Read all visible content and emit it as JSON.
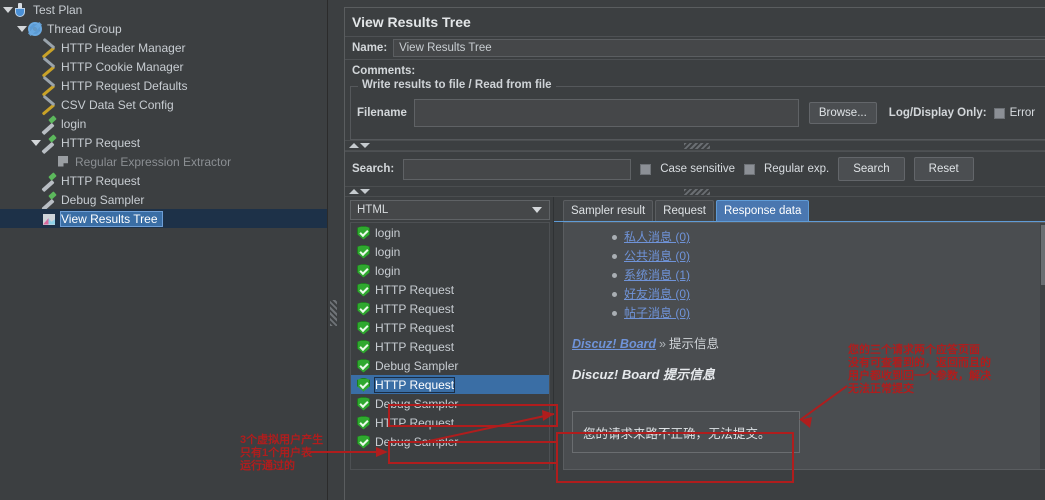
{
  "tree": {
    "items": [
      {
        "label": "Test Plan",
        "icon": "flask-icon",
        "indent": 0,
        "toggle": "open",
        "state": "normal"
      },
      {
        "label": "Thread Group",
        "icon": "gear-icon",
        "indent": 1,
        "toggle": "open",
        "state": "normal"
      },
      {
        "label": "HTTP Header Manager",
        "icon": "wrench-icon",
        "indent": 2,
        "toggle": "none",
        "state": "normal"
      },
      {
        "label": "HTTP Cookie Manager",
        "icon": "wrench-icon",
        "indent": 2,
        "toggle": "none",
        "state": "normal"
      },
      {
        "label": "HTTP Request Defaults",
        "icon": "wrench-icon",
        "indent": 2,
        "toggle": "none",
        "state": "normal"
      },
      {
        "label": "CSV Data Set Config",
        "icon": "wrench-icon",
        "indent": 2,
        "toggle": "none",
        "state": "normal"
      },
      {
        "label": "login",
        "icon": "pen-icon",
        "indent": 2,
        "toggle": "none",
        "state": "normal"
      },
      {
        "label": "HTTP Request",
        "icon": "pen-icon",
        "indent": 2,
        "toggle": "open",
        "state": "normal"
      },
      {
        "label": "Regular Expression Extractor",
        "icon": "flag-icon",
        "indent": 3,
        "toggle": "none",
        "state": "disabled"
      },
      {
        "label": "HTTP Request",
        "icon": "pen-icon",
        "indent": 2,
        "toggle": "none",
        "state": "normal"
      },
      {
        "label": "Debug Sampler",
        "icon": "pen-icon",
        "indent": 2,
        "toggle": "none",
        "state": "normal"
      },
      {
        "label": "View Results Tree",
        "icon": "chart-icon",
        "indent": 2,
        "toggle": "none",
        "state": "selected"
      }
    ]
  },
  "panel": {
    "title": "View Results Tree",
    "name_label": "Name:",
    "name_value": "View Results Tree",
    "comments_label": "Comments:",
    "comments_value": "",
    "file_group_legend": "Write results to file / Read from file",
    "filename_label": "Filename",
    "filename_value": "",
    "browse_label": "Browse...",
    "log_display_label": "Log/Display Only:",
    "errors_label": "Error"
  },
  "search": {
    "label": "Search:",
    "value": "",
    "case_sensitive_label": "Case sensitive",
    "regular_exp_label": "Regular exp.",
    "search_button": "Search",
    "reset_button": "Reset"
  },
  "renderer": {
    "selected": "HTML"
  },
  "samples": [
    {
      "label": "login",
      "status": "success",
      "selected": false
    },
    {
      "label": "login",
      "status": "success",
      "selected": false
    },
    {
      "label": "login",
      "status": "success",
      "selected": false
    },
    {
      "label": "HTTP Request",
      "status": "success",
      "selected": false
    },
    {
      "label": "HTTP Request",
      "status": "success",
      "selected": false
    },
    {
      "label": "HTTP Request",
      "status": "success",
      "selected": false
    },
    {
      "label": "HTTP Request",
      "status": "success",
      "selected": false
    },
    {
      "label": "Debug Sampler",
      "status": "success",
      "selected": false
    },
    {
      "label": "HTTP Request",
      "status": "success",
      "selected": true
    },
    {
      "label": "Debug Sampler",
      "status": "success",
      "selected": false
    },
    {
      "label": "HTTP Request",
      "status": "success",
      "selected": false
    },
    {
      "label": "Debug Sampler",
      "status": "success",
      "selected": false
    }
  ],
  "tabs": [
    {
      "label": "Sampler result",
      "active": false
    },
    {
      "label": "Request",
      "active": false
    },
    {
      "label": "Response data",
      "active": true
    }
  ],
  "response": {
    "messages": [
      "私人消息 (0)",
      "公共消息 (0)",
      "系统消息 (1)",
      "好友消息 (0)",
      "帖子消息 (0)"
    ],
    "breadcrumb_link": "Discuz! Board",
    "breadcrumb_sep": "»",
    "breadcrumb_tail": "提示信息",
    "board_title": "Discuz! Board 提示信息",
    "error_text": "您的请求来路不正确，无法提交。"
  },
  "annotations": {
    "accent_color": "#b01d1d",
    "left_note": "3个虚拟用户产生\n只有1个用户表\n运行通过的",
    "right_note": "您的三个请求两个应答页面\n没有可查看到的，返回而且的\n用户都收到回一个参数，解决\n无法正常提交"
  }
}
